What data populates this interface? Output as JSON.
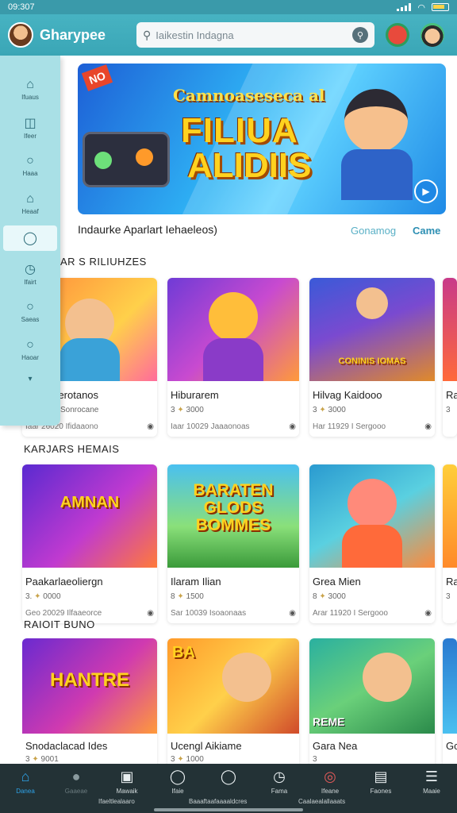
{
  "status_bar": {
    "time": "09:307"
  },
  "header": {
    "app_name": "Gharypee",
    "search_placeholder": "Iaikestin Indagna",
    "search_icon": "search-icon",
    "mic_icon": "mic-icon"
  },
  "sidebar": {
    "items": [
      {
        "label": "Ifuaus",
        "icon": "home-icon"
      },
      {
        "label": "Ifeer",
        "icon": "chat-icon"
      },
      {
        "label": "Haaa",
        "icon": "user-icon"
      },
      {
        "label": "Heaaf",
        "icon": "store-icon"
      },
      {
        "label": "",
        "icon": "tag-icon"
      },
      {
        "label": "Ifairt",
        "icon": "clock-icon"
      },
      {
        "label": "Saeas",
        "icon": "profile-icon"
      },
      {
        "label": "Haoar",
        "icon": "bubble-icon"
      }
    ],
    "more_icon": "chevron-down-icon"
  },
  "banner": {
    "badge": "NO",
    "subtitle": "Camnoaseseca al",
    "title_line1": "FILIUA",
    "title_line2": "ALIDIIS",
    "caption": "Indaurke Aparlart Iehaeleos)",
    "link_1": "Gonamog",
    "link_2": "Came"
  },
  "sections": [
    {
      "title": "AR S RILIUHZES",
      "cards": [
        {
          "name": "Hamerotanos",
          "rating": "2",
          "rating_detail": "Sonrocane",
          "meta": "Iaar 26020 Ifidaaono",
          "thumb_text": ""
        },
        {
          "name": "Hiburarem",
          "rating": "3",
          "rating_detail": "3000",
          "meta": "Iaar 10029 Jaaaonoas",
          "thumb_text": ""
        },
        {
          "name": "Hilvag Kaidooo",
          "rating": "3",
          "rating_detail": "3000",
          "meta": "Har 11929 I Sergooo",
          "thumb_text": "CONINIS IOMAS"
        },
        {
          "name": "Ra",
          "rating": "3",
          "rating_detail": "",
          "meta": "",
          "thumb_text": ""
        }
      ]
    },
    {
      "title": "KARJARS HEMAIS",
      "cards": [
        {
          "name": "Paakarlaeoliergn",
          "rating": "3.",
          "rating_detail": "0000",
          "meta": "Geo 20029 Ilfaaeorce",
          "thumb_text": "AMNAN"
        },
        {
          "name": "Ilaram Ilian",
          "rating": "8",
          "rating_detail": "1500",
          "meta": "Sar 10039 Isoaonaas",
          "thumb_text": "BARATEN GLODS BOMMES"
        },
        {
          "name": "Grea Mien",
          "rating": "8",
          "rating_detail": "3000",
          "meta": "Arar 11920 I Sergooo",
          "thumb_text": ""
        },
        {
          "name": "Ra",
          "rating": "3",
          "rating_detail": "",
          "meta": "",
          "thumb_text": ""
        }
      ]
    },
    {
      "title": "RAIOIT BUNO",
      "cards": [
        {
          "name": "Snodaclacad Ides",
          "rating": "3",
          "rating_detail": "9001",
          "meta": "",
          "thumb_text": "HANTRE"
        },
        {
          "name": "Ucengl Aikiame",
          "rating": "3",
          "rating_detail": "1000",
          "meta": "",
          "thumb_text": "BA"
        },
        {
          "name": "Gara Nea",
          "rating": "3",
          "rating_detail": "",
          "meta": "",
          "thumb_text": "REME"
        },
        {
          "name": "Gc",
          "rating": "",
          "rating_detail": "",
          "meta": "",
          "thumb_text": ""
        }
      ]
    }
  ],
  "bottom_nav": {
    "items": [
      {
        "label": "Danea",
        "icon": "home-icon"
      },
      {
        "label": "Gaaeae",
        "icon": "game-icon"
      },
      {
        "label": "Mawaik",
        "icon": "gift-icon"
      },
      {
        "label": "Ifaie",
        "icon": "chat-icon"
      },
      {
        "label": "",
        "icon": "circle-icon"
      },
      {
        "label": "Fama",
        "icon": "timer-icon"
      },
      {
        "label": "Ifeane",
        "icon": "target-icon"
      },
      {
        "label": "Faones",
        "icon": "book-icon"
      },
      {
        "label": "Maaie",
        "icon": "menu-icon"
      }
    ],
    "sub_1": "Ifaeltlealaaro",
    "sub_2": "Baaaftaafaaaaldcres",
    "sub_3": "Caalaealallaaats"
  }
}
